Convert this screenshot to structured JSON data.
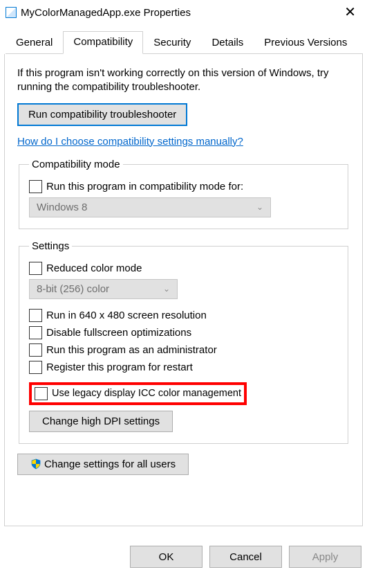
{
  "window": {
    "title": "MyColorManagedApp.exe Properties"
  },
  "tabs": {
    "general": "General",
    "compatibility": "Compatibility",
    "security": "Security",
    "details": "Details",
    "previous": "Previous Versions"
  },
  "intro": "If this program isn't working correctly on this version of Windows, try running the compatibility troubleshooter.",
  "troubleshooter_btn": "Run compatibility troubleshooter",
  "help_link": "How do I choose compatibility settings manually?",
  "compat_mode": {
    "legend": "Compatibility mode",
    "checkbox_label": "Run this program in compatibility mode for:",
    "selected": "Windows 8"
  },
  "settings": {
    "legend": "Settings",
    "reduced_color": "Reduced color mode",
    "color_selected": "8-bit (256) color",
    "run640": "Run in 640 x 480 screen resolution",
    "disable_fs": "Disable fullscreen optimizations",
    "run_admin": "Run this program as an administrator",
    "register_restart": "Register this program for restart",
    "legacy_icc": "Use legacy display ICC color management",
    "high_dpi_btn": "Change high DPI settings"
  },
  "all_users_btn": "Change settings for all users",
  "buttons": {
    "ok": "OK",
    "cancel": "Cancel",
    "apply": "Apply"
  }
}
